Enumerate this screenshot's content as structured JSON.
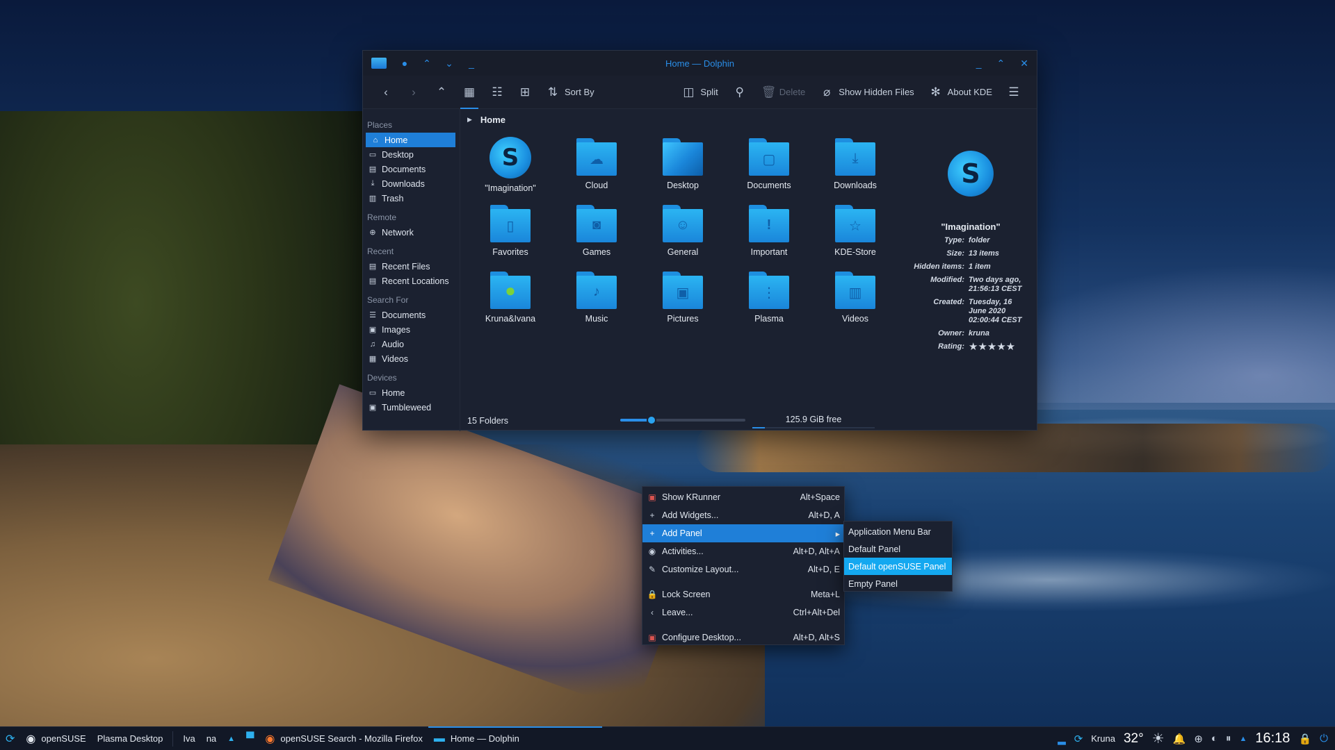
{
  "window": {
    "title": "Home — Dolphin",
    "toolbar": {
      "sort_by": "Sort By",
      "split": "Split",
      "delete": "Delete",
      "show_hidden": "Show Hidden Files",
      "about": "About KDE"
    },
    "sidebar": {
      "places_title": "Places",
      "places": [
        "Home",
        "Desktop",
        "Documents",
        "Downloads",
        "Trash"
      ],
      "remote_title": "Remote",
      "remote": [
        "Network"
      ],
      "recent_title": "Recent",
      "recent": [
        "Recent Files",
        "Recent Locations"
      ],
      "search_title": "Search For",
      "search": [
        "Documents",
        "Images",
        "Audio",
        "Videos"
      ],
      "devices_title": "Devices",
      "devices": [
        "Home",
        "Tumbleweed"
      ]
    },
    "breadcrumb": "Home",
    "items": [
      "\"Imagination\"",
      "Cloud",
      "Desktop",
      "Documents",
      "Downloads",
      "Favorites",
      "Games",
      "General",
      "Important",
      "KDE-Store",
      "Kruna&Ivana",
      "Music",
      "Pictures",
      "Plasma",
      "Videos"
    ],
    "info": {
      "name": "\"Imagination\"",
      "rows": [
        {
          "k": "Type:",
          "v": "folder"
        },
        {
          "k": "Size:",
          "v": "13 items"
        },
        {
          "k": "Hidden items:",
          "v": "1 item"
        },
        {
          "k": "Modified:",
          "v": "Two days ago, 21:56:13 CEST"
        },
        {
          "k": "Created:",
          "v": "Tuesday, 16 June 2020 02:00:44 CEST"
        },
        {
          "k": "Owner:",
          "v": "kruna"
        },
        {
          "k": "Rating:",
          "v": "★★★★★"
        }
      ],
      "rating": 5
    },
    "status": {
      "count": "15 Folders",
      "free": "125.9 GiB free",
      "zoom_fraction": 0.25,
      "used_fraction": 0.1
    }
  },
  "menu": {
    "items": [
      {
        "label": "Show KRunner",
        "shortcut": "Alt+Space"
      },
      {
        "label": "Add Widgets...",
        "shortcut": "Alt+D, A"
      },
      {
        "label": "Add Panel",
        "shortcut": ""
      },
      {
        "label": "Activities...",
        "shortcut": "Alt+D, Alt+A"
      },
      {
        "label": "Customize Layout...",
        "shortcut": "Alt+D, E"
      },
      {
        "label": "Lock Screen",
        "shortcut": "Meta+L"
      },
      {
        "label": "Leave...",
        "shortcut": "Ctrl+Alt+Del"
      },
      {
        "label": "Configure Desktop...",
        "shortcut": "Alt+D, Alt+S"
      }
    ],
    "submenu": [
      "Application Menu Bar",
      "Default Panel",
      "Default openSUSE Panel",
      "Empty Panel"
    ]
  },
  "taskbar": {
    "activity": "openSUSE",
    "desktop": "Plasma Desktop",
    "desk1": "Iva",
    "desk2": "na",
    "task_firefox": "openSUSE Search - Mozilla Firefox",
    "task_dolphin": "Home — Dolphin",
    "user": "Kruna",
    "temp": "32°",
    "clock": "16:18"
  }
}
